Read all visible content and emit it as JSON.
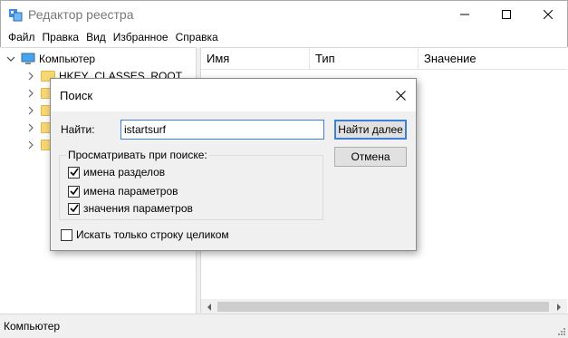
{
  "window": {
    "title": "Редактор реестра"
  },
  "menu": [
    "Файл",
    "Правка",
    "Вид",
    "Избранное",
    "Справка"
  ],
  "tree": {
    "root_label": "Компьютер",
    "first_child_label": "HKEY_CLASSES_ROOT"
  },
  "list": {
    "columns": [
      "Имя",
      "Тип",
      "Значение"
    ]
  },
  "status": {
    "path": "Компьютер"
  },
  "find_dialog": {
    "title": "Поиск",
    "find_label": "Найти:",
    "find_value": "istartsurf",
    "find_next_label": "Найти далее",
    "cancel_label": "Отмена",
    "look_at_label": "Просматривать при поиске:",
    "options": [
      {
        "label": "имена разделов",
        "checked": true
      },
      {
        "label": "имена параметров",
        "checked": true
      },
      {
        "label": "значения параметров",
        "checked": true
      }
    ],
    "whole_string": {
      "label": "Искать только строку целиком",
      "checked": false
    }
  }
}
